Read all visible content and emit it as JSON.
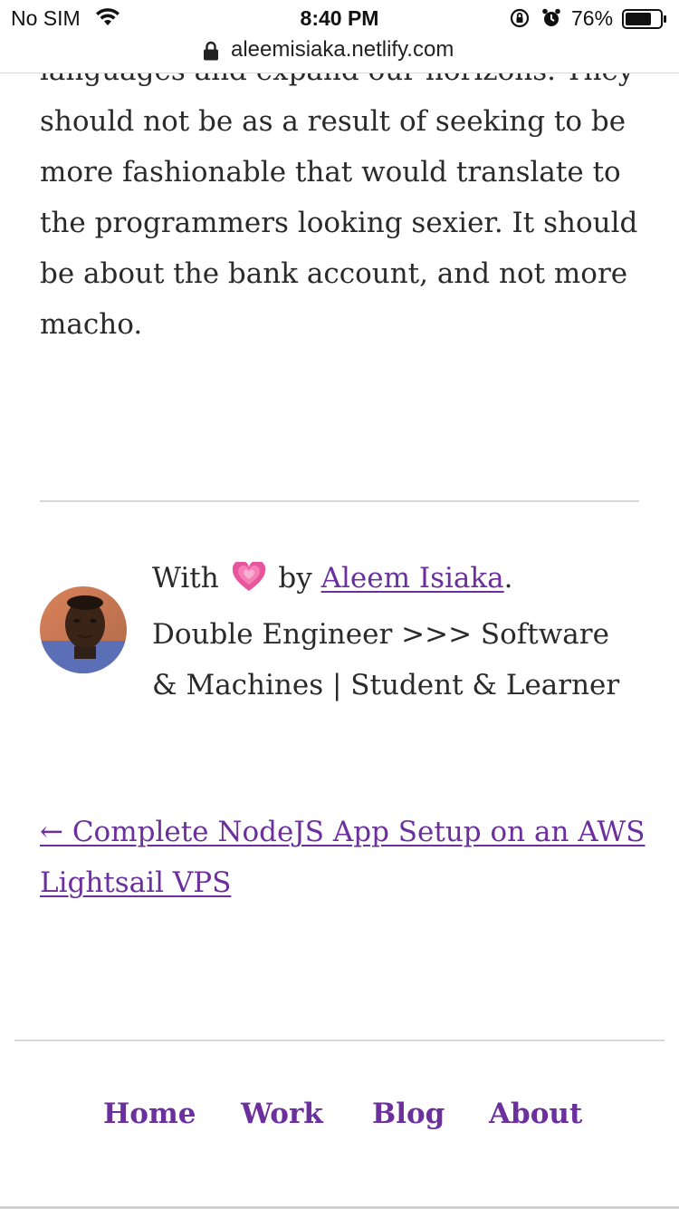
{
  "status_bar": {
    "carrier": "No SIM",
    "time": "8:40 PM",
    "battery_percent": "76%",
    "battery_level": 0.76,
    "icons": [
      "wifi-icon",
      "orientation-lock-icon",
      "alarm-icon",
      "battery-icon"
    ]
  },
  "browser": {
    "url": "aleemisiaka.netlify.com",
    "lock_icon": "lock-icon"
  },
  "article": {
    "partial_top_line": "languages and expand our horizons. They",
    "paragraph": "should not be as a result of seeking to be more fashionable that would translate to the programmers looking sexier. It should be about the bank account, and not more macho."
  },
  "author": {
    "prefix": "With",
    "heart_icon": "heart-icon",
    "by": "by",
    "name": "Aleem Isiaka",
    "period": ".",
    "bio": "Double Engineer >>> Software & Machines | Student & Learner"
  },
  "navigation": {
    "previous_post": "← Complete NodeJS App Setup on an AWS Lightsail VPS"
  },
  "footer": {
    "items": [
      "Home",
      "Work",
      "Blog",
      "About"
    ]
  },
  "colors": {
    "link": "#6b2f9e",
    "text": "#2a2a2a",
    "divider": "#d7d7d7",
    "heart": "#e8559a"
  }
}
